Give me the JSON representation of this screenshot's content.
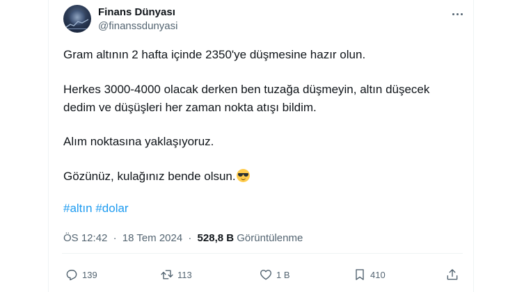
{
  "author": {
    "display_name": "Finans Dünyası",
    "handle": "@finanssdunyasi",
    "avatar_icon": "avatar-icon"
  },
  "tweet": {
    "lines": [
      "Gram altının 2 hafta içinde 2350'ye düşmesine hazır olun.",
      "Herkes 3000-4000 olacak derken ben tuzağa düşmeyin, altın düşecek",
      "dedim ve düşüşleri her zaman nokta atışı bildim.",
      "Alım noktasına yaklaşıyoruz.",
      "Gözünüz, kulağınız bende olsun."
    ],
    "emoji": "sunglasses-face-emoji",
    "hashtags": [
      "#altın",
      "#dolar"
    ]
  },
  "meta": {
    "time": "ÖS 12:42",
    "date": "18 Tem 2024",
    "separator": "·",
    "views": "528,8 B",
    "views_label": "Görüntülenme"
  },
  "actions": {
    "replies": "139",
    "retweets": "113",
    "likes": "1 B",
    "bookmarks": "410"
  },
  "colors": {
    "link": "#1d9bf0",
    "text": "#0f1419",
    "secondary": "#536471",
    "border": "#eff3f4"
  }
}
